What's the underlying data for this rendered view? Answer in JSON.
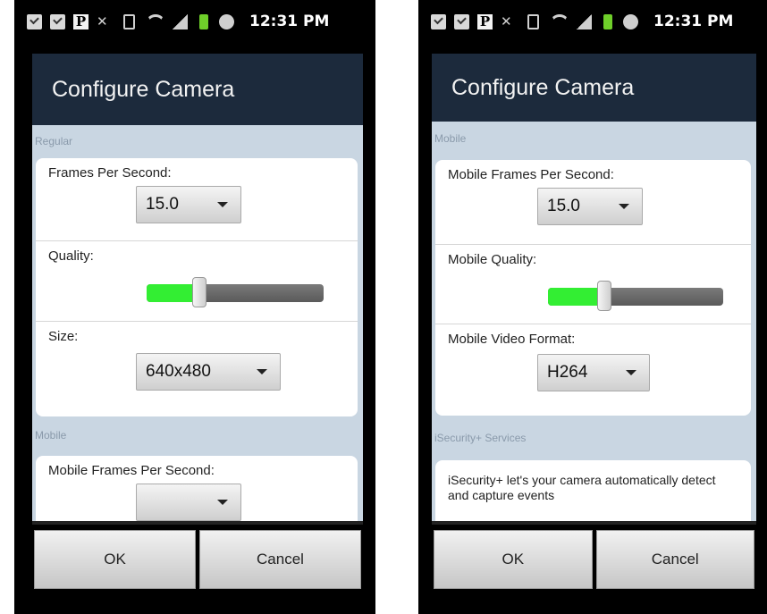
{
  "status_bar": {
    "time": "12:31 PM"
  },
  "screens": [
    {
      "dialog_title": "Configure Camera",
      "sections": [
        {
          "heading": "Regular",
          "frames_label": "Frames Per Second:",
          "frames_value": "15.0",
          "quality_label": "Quality:",
          "quality_level": 0.3,
          "size_label": "Size:",
          "size_value": "640x480"
        },
        {
          "heading": "Mobile",
          "frames_label": "Mobile Frames Per Second:"
        }
      ],
      "buttons": {
        "ok": "OK",
        "cancel": "Cancel"
      }
    },
    {
      "dialog_title": "Configure Camera",
      "sections": [
        {
          "heading": "Mobile",
          "frames_label": "Mobile Frames Per Second:",
          "frames_value": "15.0",
          "quality_label": "Mobile Quality:",
          "quality_level": 0.32,
          "format_label": "Mobile Video Format:",
          "format_value": "H264"
        },
        {
          "heading": "iSecurity+ Services",
          "description": "iSecurity+ let's your camera automatically detect and capture events"
        }
      ],
      "buttons": {
        "ok": "OK",
        "cancel": "Cancel"
      }
    }
  ],
  "colors": {
    "header_bg": "#1c2a3c",
    "dialog_bg": "#c9d6e2",
    "slider_fill": "#33ee33"
  }
}
